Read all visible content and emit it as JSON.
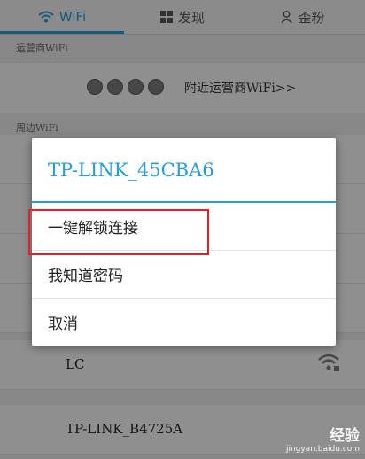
{
  "tabs": [
    {
      "label": "WiFi",
      "icon": "wifi-icon",
      "active": true
    },
    {
      "label": "发现",
      "icon": "grid-icon",
      "active": false
    },
    {
      "label": "歪粉",
      "icon": "person-icon",
      "active": false
    }
  ],
  "carrier_section": {
    "label": "运营商WiFi",
    "link": "附近运营商WiFi>>",
    "icons": [
      "chinanet-icon",
      "cmcc-icon",
      "unicom-icon",
      "operator-icon"
    ]
  },
  "nearby_section": {
    "label": "周边WiFi"
  },
  "networks": [
    {
      "name": "LC"
    },
    {
      "name": "TP-LINK_B4725A"
    }
  ],
  "dialog": {
    "title": "TP-LINK_45CBA6",
    "options": [
      "一键解锁连接",
      "我知道密码",
      "取消"
    ]
  },
  "watermark": {
    "text": "经验",
    "url": "jingyan.baidu.com"
  },
  "colors": {
    "accent": "#2b9bd6",
    "highlight": "#e5202a"
  }
}
